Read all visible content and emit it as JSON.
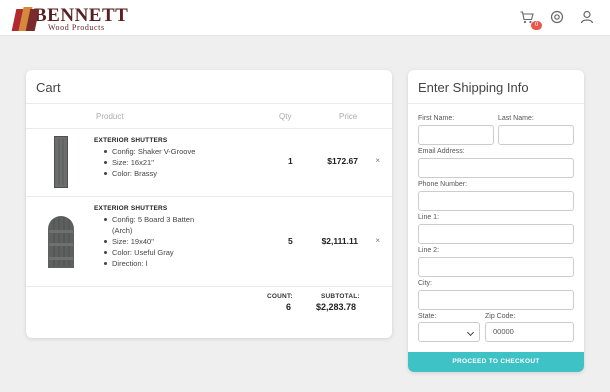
{
  "brand": {
    "name": "BENNETT",
    "sub": "Wood Products"
  },
  "header": {
    "cart_count": "0"
  },
  "cart": {
    "title": "Cart",
    "columns": {
      "product": "Product",
      "qty": "Qty",
      "price": "Price"
    },
    "items": [
      {
        "name": "EXTERIOR SHUTTERS",
        "details": [
          "Config: Shaker V-Groove",
          "Size: 16x21\"",
          "Color: Brassy"
        ],
        "qty": "1",
        "price": "$172.67",
        "remove": "×"
      },
      {
        "name": "EXTERIOR SHUTTERS",
        "details": [
          "Config: 5 Board 3 Batten",
          "(Arch)",
          "Size: 19x40\"",
          "Color: Useful Gray",
          "Direction: l"
        ],
        "qty": "5",
        "price": "$2,111.11",
        "remove": "×"
      }
    ],
    "summary": {
      "count_label": "COUNT:",
      "count": "6",
      "subtotal_label": "SUBTOTAL:",
      "subtotal": "$2,283.78"
    }
  },
  "shipping": {
    "title": "Enter Shipping Info",
    "first_name_label": "First Name:",
    "last_name_label": "Last Name:",
    "email_label": "Email Address:",
    "phone_label": "Phone Number:",
    "line1_label": "Line 1:",
    "line2_label": "Line 2:",
    "city_label": "City:",
    "state_label": "State:",
    "zip_label": "Zip Code:",
    "zip_placeholder": "00000",
    "checkout_label": "PROCEED TO CHECKOUT"
  },
  "colors": {
    "accent": "#3fc2c6",
    "badge": "#e8574b",
    "brand": "#5a1f1f"
  },
  "icons": [
    "cart-icon",
    "settings-icon",
    "user-icon",
    "close-icon",
    "chevron-down-icon"
  ]
}
